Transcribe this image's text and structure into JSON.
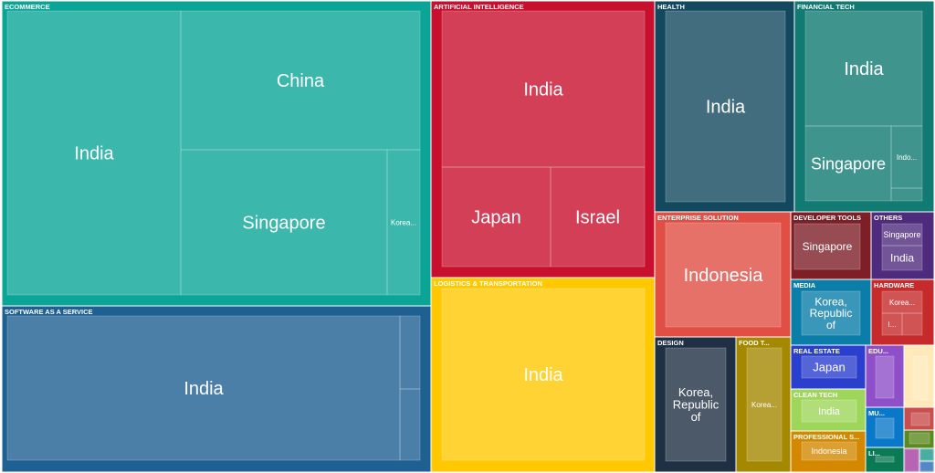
{
  "chart_data": {
    "type": "treemap",
    "title": "",
    "groups": [
      {
        "name": "ECOMMERCE",
        "color": "#0aa596",
        "children": [
          {
            "label": "India",
            "value": 42
          },
          {
            "label": "China",
            "value": 24
          },
          {
            "label": "Singapore",
            "value": 28
          },
          {
            "label": "Korea...",
            "value": 3
          }
        ]
      },
      {
        "name": "SOFTWARE AS A SERVICE",
        "color": "#1e6091",
        "children": [
          {
            "label": "India",
            "value": 45
          },
          {
            "label": "",
            "value": 1
          },
          {
            "label": "",
            "value": 1
          }
        ]
      },
      {
        "name": "ARTIFICIAL INTELLIGENCE",
        "color": "#c8102e",
        "children": [
          {
            "label": "India",
            "value": 20
          },
          {
            "label": "Japan",
            "value": 9
          },
          {
            "label": "Israel",
            "value": 8
          }
        ]
      },
      {
        "name": "LOGISTICS & TRANSPORTATION",
        "color": "#ffc800",
        "children": [
          {
            "label": "India",
            "value": 23
          }
        ]
      },
      {
        "name": "HEALTH",
        "color": "#12495f",
        "children": [
          {
            "label": "India",
            "value": 20
          }
        ]
      },
      {
        "name": "FINANCIAL TECH",
        "color": "#117a72",
        "children": [
          {
            "label": "India",
            "value": 11
          },
          {
            "label": "Singapore",
            "value": 7
          },
          {
            "label": "Indo...",
            "value": 1.5
          },
          {
            "label": "",
            "value": 0.4
          }
        ]
      },
      {
        "name": "ENTERPRISE SOLUTION",
        "color": "#e04e44",
        "children": [
          {
            "label": "Indonesia",
            "value": 11
          }
        ]
      },
      {
        "name": "DEVELOPER TOOLS",
        "color": "#7e1e27",
        "children": [
          {
            "label": "Singapore",
            "value": 4
          }
        ]
      },
      {
        "name": "OTHERS",
        "color": "#4f2b7e",
        "children": [
          {
            "label": "Singapore",
            "value": 1.5
          },
          {
            "label": "India",
            "value": 1.2
          }
        ]
      },
      {
        "name": "MEDIA",
        "color": "#0a7ea8",
        "children": [
          {
            "label": "Korea, Republic of",
            "value": 4
          }
        ]
      },
      {
        "name": "HARDWARE",
        "color": "#c62a2a",
        "children": [
          {
            "label": "Korea...",
            "value": 1.5
          },
          {
            "label": "I...",
            "value": 0.6
          },
          {
            "label": "",
            "value": 0.6
          }
        ]
      },
      {
        "name": "DESIGN",
        "color": "#1f3044",
        "children": [
          {
            "label": "Korea, Republic of",
            "value": 8
          }
        ]
      },
      {
        "name": "FOOD T...",
        "color": "#a48800",
        "children": [
          {
            "label": "Korea...",
            "value": 5
          }
        ]
      },
      {
        "name": "REAL ESTATE",
        "color": "#2b3fce",
        "children": [
          {
            "label": "Japan",
            "value": 2
          }
        ]
      },
      {
        "name": "EDU...",
        "color": "#8e4fc8",
        "children": [
          {
            "label": "",
            "value": 1.5
          }
        ]
      },
      {
        "name": "",
        "color": "#ffe9b8",
        "children": [
          {
            "label": "",
            "value": 1.5
          }
        ]
      },
      {
        "name": "CLEAN TECH",
        "color": "#9ed65a",
        "children": [
          {
            "label": "India",
            "value": 1.5
          }
        ]
      },
      {
        "name": "PROFESSIONAL S...",
        "color": "#d48800",
        "children": [
          {
            "label": "Indonesia",
            "value": 1.5
          }
        ]
      },
      {
        "name": "MU...",
        "color": "#0a78c8",
        "children": [
          {
            "label": "",
            "value": 0.8
          }
        ]
      },
      {
        "name": "LI...",
        "color": "#0a7a55",
        "children": [
          {
            "label": "",
            "value": 0.6
          }
        ]
      },
      {
        "name": "",
        "color": "#c94e4e",
        "children": [
          {
            "label": "",
            "value": 0.4
          }
        ]
      },
      {
        "name": "",
        "color": "#5a8a20",
        "children": [
          {
            "label": "",
            "value": 0.4
          }
        ]
      },
      {
        "name": "",
        "color": "#a63fa0",
        "children": [
          {
            "label": "",
            "value": 0.3
          }
        ]
      },
      {
        "name": "",
        "color": "#1a9a8a",
        "children": [
          {
            "label": "",
            "value": 0.3
          }
        ]
      },
      {
        "name": "",
        "color": "#2a6ab8",
        "children": [
          {
            "label": "",
            "value": 0.2
          }
        ]
      }
    ]
  }
}
